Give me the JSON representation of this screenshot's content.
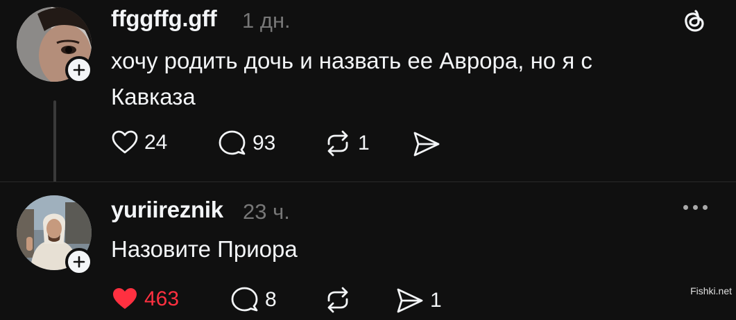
{
  "post1": {
    "username": "ffggffg.gff",
    "time": "1 дн.",
    "text_line1": "хочу родить дочь и назвать ее Аврора, но я с",
    "text_line2": "Кавказа",
    "likes": "24",
    "replies": "93",
    "reposts": "1",
    "avatar_icon": "user-avatar",
    "follow_icon": "plus-icon"
  },
  "post2": {
    "username": "yuriireznik",
    "time": "23 ч.",
    "text": "Назовите Приора",
    "likes": "463",
    "replies": "8",
    "reposts": "",
    "shares": "1",
    "liked": true,
    "like_color": "#ff3040"
  },
  "header": {
    "brand_icon": "threads-logo-icon"
  },
  "watermark": "Fishki.net"
}
